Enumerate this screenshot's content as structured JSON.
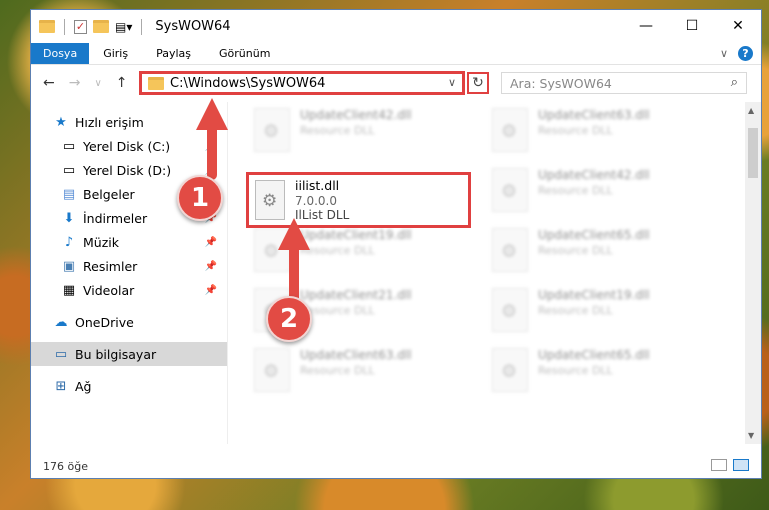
{
  "window": {
    "title": "SysWOW64",
    "controls": {
      "minimize": "—",
      "maximize": "☐",
      "close": "✕"
    }
  },
  "ribbon": {
    "tabs": [
      "Dosya",
      "Giriş",
      "Paylaş",
      "Görünüm"
    ],
    "expand_glyph": "∨",
    "help_glyph": "?"
  },
  "navigation": {
    "back_glyph": "←",
    "forward_glyph": "→",
    "recent_glyph": "∨",
    "up_glyph": "↑",
    "address": "C:\\Windows\\SysWOW64",
    "address_dropdown_glyph": "∨",
    "refresh_glyph": "↻",
    "search_placeholder": "Ara: SysWOW64",
    "search_glyph": "⌕"
  },
  "sidebar": {
    "quick_access": "Hızlı erişim",
    "items": [
      {
        "label": "Yerel Disk (C:)",
        "icon": "drive-icon",
        "pinned": true
      },
      {
        "label": "Yerel Disk (D:)",
        "icon": "drive-icon",
        "pinned": true
      },
      {
        "label": "Belgeler",
        "icon": "documents-icon",
        "pinned": true
      },
      {
        "label": "İndirmeler",
        "icon": "downloads-icon",
        "pinned": true
      },
      {
        "label": "Müzik",
        "icon": "music-icon",
        "pinned": true
      },
      {
        "label": "Resimler",
        "icon": "pictures-icon",
        "pinned": true
      },
      {
        "label": "Videolar",
        "icon": "videos-icon",
        "pinned": true
      }
    ],
    "onedrive": "OneDrive",
    "this_pc": "Bu bilgisayar",
    "network": "Ağ"
  },
  "files": {
    "highlighted": {
      "name": "iilist.dll",
      "version": "7.0.0.0",
      "description": "IlList DLL"
    },
    "blurred": [
      {
        "name": "UpdateClient42.dll",
        "desc": "Resource DLL"
      },
      {
        "name": "UpdateClient63.dll",
        "desc": "Resource DLL"
      },
      {
        "name": "UpdateClient42.dll",
        "desc": "Resource DLL"
      },
      {
        "name": "UpdateClient19.dll",
        "desc": "Resource DLL"
      },
      {
        "name": "UpdateClient65.dll",
        "desc": "Resource DLL"
      },
      {
        "name": "UpdateClient21.dll",
        "desc": "Resource DLL"
      },
      {
        "name": "UpdateClient19.dll",
        "desc": "Resource DLL"
      },
      {
        "name": "UpdateClient63.dll",
        "desc": "Resource DLL"
      },
      {
        "name": "UpdateClient65.dll",
        "desc": "Resource DLL"
      }
    ]
  },
  "status": {
    "count": "176 öğe"
  },
  "steps": [
    "1",
    "2"
  ],
  "colors": {
    "accent": "#1979ca",
    "highlight": "#e04040",
    "badge": "#e24b44"
  }
}
